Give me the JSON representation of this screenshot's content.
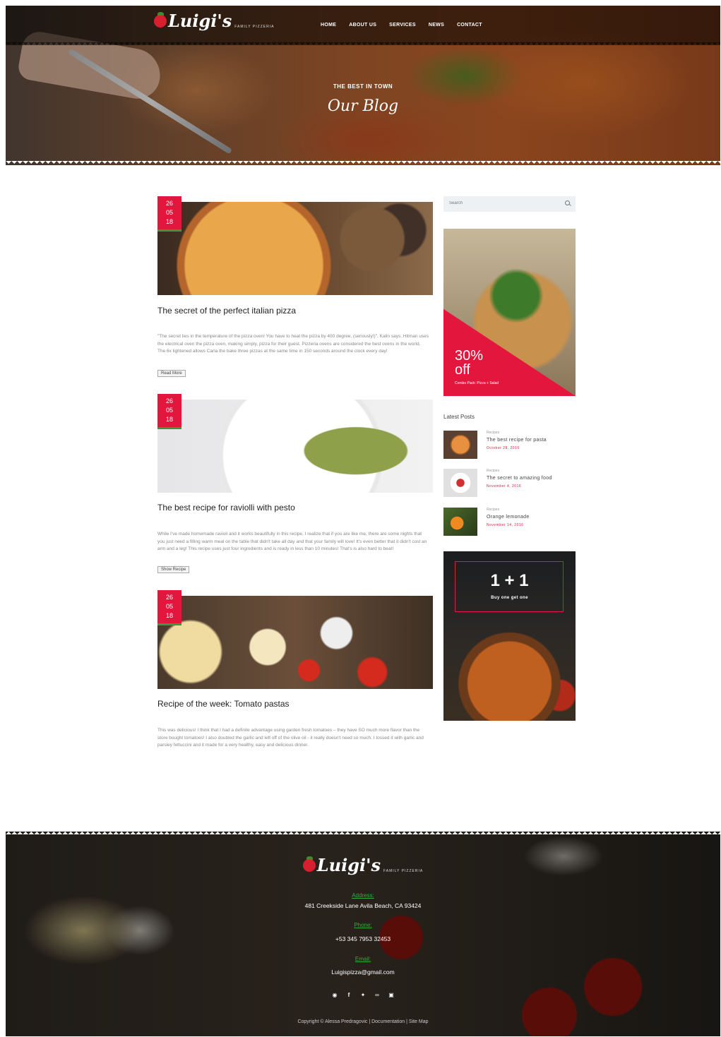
{
  "brand": {
    "name": "Luigi's",
    "sub": "FAMILY PIZZERIA"
  },
  "nav": [
    "HOME",
    "ABOUT US",
    "SERVICES",
    "NEWS",
    "CONTACT"
  ],
  "hero": {
    "tagline": "THE BEST IN TOWN",
    "title": "Our Blog"
  },
  "posts": [
    {
      "day": "26",
      "month": "05",
      "year": "18",
      "title": "The secret of the perfect italian pizza",
      "text": "\"The secret lies in the temperature of the pizza oven! You have to heat the pizza by 400 degree, (seriously!)\", Kalin says. Hitman uses the electrical oven the pizza oven, making simply, pizza for their guest. Pizzeria ovens are considered the best ovens in the world. The 6x lightened allows Carla the bake three pizzas at the same time in 150 seconds around the clock every day!",
      "button": "Read More"
    },
    {
      "day": "26",
      "month": "05",
      "year": "18",
      "title": "The best recipe for raviolli with pesto",
      "text": "While I've made homemade ravioli and it works beautifully in this recipe, I realize that if you are like me, there are some nights that you just need a filling warm meal on the table that didn't take all day and that your family will love! It's even better that it didn't cost an arm and a leg! This recipe uses just four ingredients and is ready in less than 10 minutes! That's is also hard to beat!",
      "button": "Show Recipe"
    },
    {
      "day": "26",
      "month": "05",
      "year": "18",
      "title": "Recipe of the week: Tomato pastas",
      "text": "This was delicious! I think that I had a definite advantage using garden fresh tomatoes – they have SO much more flavor than the store bought tomatoes! I also doubled the garlic and left off of the olive oil - it really doesn't need so much. I tossed it with garlic and parsley fettuccini and it made for a very healthy, easy and delicious dinner."
    }
  ],
  "sidebar": {
    "search_placeholder": "Search",
    "promo": {
      "percent": "30%",
      "off": "off",
      "sub": "Combo Pack: Pizza + Salad"
    },
    "latest_title": "Latest Posts",
    "latest": [
      {
        "category": "Recipes",
        "title": "The best recipe for pasta",
        "date": "October 28, 2016"
      },
      {
        "category": "Recipes",
        "title": "The secret to amazing food",
        "date": "November 4, 2016"
      },
      {
        "category": "Recipes",
        "title": "Orange lemonade",
        "date": "November 14, 2016"
      }
    ],
    "promo2": {
      "big": "1 + 1",
      "sub": "Buy one get one"
    }
  },
  "footer": {
    "address_label": "Address:",
    "address": "481 Creekside Lane Avila Beach, CA 93424",
    "phone_label": "Phone:",
    "phone": "+53 345 7953 32453",
    "email_label": "Email:",
    "email": "Luigispizza@gmail.com",
    "copyright": "Copyright © Alessa Predragovic",
    "links": [
      "Documentation",
      "Site Map"
    ]
  },
  "colors": {
    "accent": "#e3173e",
    "green": "#3aa640"
  }
}
